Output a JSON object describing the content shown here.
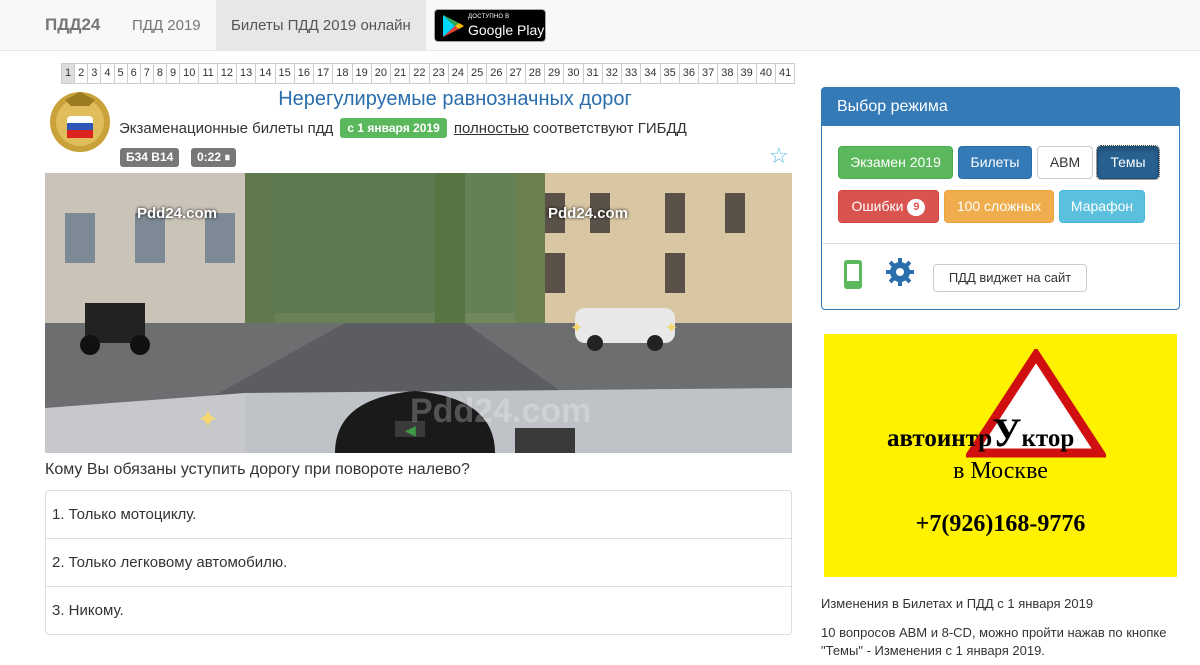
{
  "nav": {
    "brand": "ПДД24",
    "link1": "ПДД 2019",
    "link2": "Билеты ПДД 2019 онлайн",
    "gplay_small": "ДОСТУПНО В",
    "gplay_big": "Google Play"
  },
  "pager": [
    "1",
    "2",
    "3",
    "4",
    "5",
    "6",
    "7",
    "8",
    "9",
    "10",
    "11",
    "12",
    "13",
    "14",
    "15",
    "16",
    "17",
    "18",
    "19",
    "20",
    "21",
    "22",
    "23",
    "24",
    "25",
    "26",
    "27",
    "28",
    "29",
    "30",
    "31",
    "32",
    "33",
    "34",
    "35",
    "36",
    "37",
    "38",
    "39",
    "40",
    "41"
  ],
  "pager_active": "1",
  "header": {
    "title": "Нерегулируемые равнозначных дорог",
    "subtitle_before": "Экзаменационные билеты пдд",
    "date_badge": "с 1 января 2019",
    "subtitle_link": "полностью",
    "subtitle_after": "соответствуют ГИБДД",
    "ticket_badge": "Б34 В14",
    "timer_badge": "0:22 ⏸"
  },
  "scene": {
    "watermark1": "Pdd24.com",
    "watermark2": "Pdd24.com",
    "watermark3": "Pdd24.com"
  },
  "question": "Кому Вы обязаны уступить дорогу при повороте налево?",
  "answers": [
    "1. Только мотоциклу.",
    "2. Только легковому автомобилю.",
    "3. Никому."
  ],
  "panel": {
    "title": "Выбор режима",
    "exam": "Экзамен 2019",
    "tickets": "Билеты",
    "abm": "АВМ",
    "themes": "Темы",
    "errors": "Ошибки",
    "errors_count": "9",
    "hard": "100 сложных",
    "marathon": "Марафон",
    "widget": "ПДД виджет на сайт"
  },
  "ad": {
    "line1_pre": "автоинтр",
    "line1_big": "У",
    "line1_post": "ктор",
    "line2": "в Москве",
    "line3": "+7(926)168-9776"
  },
  "news": {
    "n1": "Изменения в Билетах и ПДД с 1 января 2019",
    "n2": "10 вопросов АВМ и 8-CD, можно пройти нажав по кнопке \"Темы\" - Изменения с 1 января 2019."
  }
}
